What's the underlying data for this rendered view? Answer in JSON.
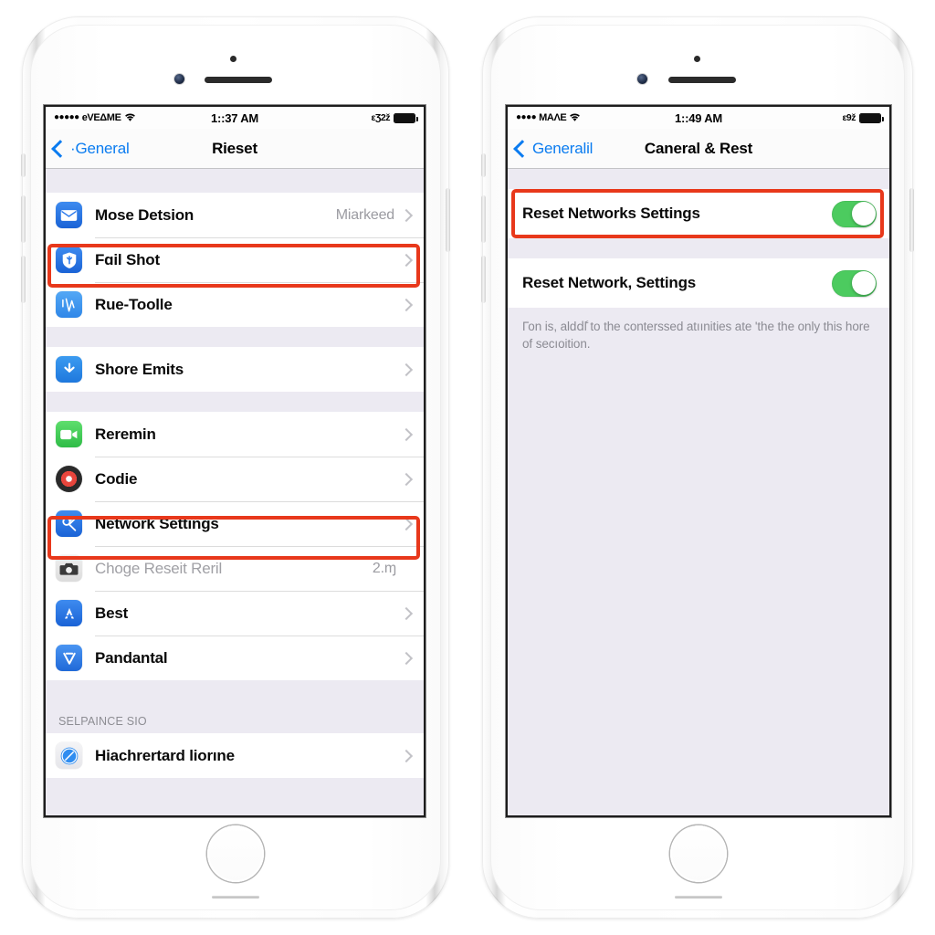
{
  "left_phone": {
    "status_bar": {
      "signal_dots": "●●●●●",
      "carrier": "eVEΔME",
      "wifi_icon": "wifi-icon",
      "time": "1::37 AM",
      "bluetooth": "εƷ2ž",
      "battery_icon": "battery-full-icon"
    },
    "nav": {
      "back_label": "·General",
      "title": "Rieset"
    },
    "groups": [
      {
        "rows": [
          {
            "label": "Mose Detsion",
            "value": "Miarkeed",
            "icon": "mail-icon",
            "icon_class": "ico-mail",
            "glyph": "✉",
            "dim": false,
            "highlight": false
          },
          {
            "label": "Fɑil Shot",
            "value": "",
            "icon": "shield-icon",
            "icon_class": "ico-shield",
            "glyph": "Ⓨ",
            "dim": false,
            "highlight": true
          },
          {
            "label": "Rue-Toolle",
            "value": "",
            "icon": "wave-icon",
            "icon_class": "ico-wave",
            "glyph": "Ⓥ",
            "dim": false,
            "highlight": false
          }
        ]
      },
      {
        "rows": [
          {
            "label": "Shore Emits",
            "value": "",
            "icon": "download-arrow-icon",
            "icon_class": "ico-arrow",
            "glyph": "⬇",
            "dim": false,
            "highlight": false
          }
        ]
      },
      {
        "rows": [
          {
            "label": "Reremin",
            "value": "",
            "icon": "facetime-camera-icon",
            "icon_class": "ico-facetime",
            "glyph": "▶",
            "dim": false,
            "highlight": false
          },
          {
            "label": "Codie",
            "value": "",
            "icon": "chrome-icon",
            "icon_class": "ico-chrome",
            "glyph": "",
            "dim": false,
            "highlight": false
          },
          {
            "label": "Network Settings",
            "value": "",
            "icon": "network-settings-icon",
            "icon_class": "ico-net",
            "glyph": "✂",
            "dim": false,
            "highlight": true
          },
          {
            "label": "Choge Reseit Reril",
            "value": "2.ɱ",
            "icon": "camera-icon",
            "icon_class": "ico-camera",
            "glyph": "📷",
            "dim": true,
            "highlight": false
          },
          {
            "label": "Best",
            "value": "",
            "icon": "app-store-icon",
            "icon_class": "ico-appstore",
            "glyph": "A",
            "dim": false,
            "highlight": false
          },
          {
            "label": "Pandantal",
            "value": "",
            "icon": "vee-icon",
            "icon_class": "ico-vee",
            "glyph": "Ⓥ",
            "dim": false,
            "highlight": false
          }
        ]
      }
    ],
    "section_header": "SELPAINCE SıO",
    "last_group": {
      "rows": [
        {
          "label": "Hiachrertard liorıne",
          "value": "",
          "icon": "safari-compass-icon",
          "icon_class": "ico-safari",
          "glyph": "⦿",
          "dim": false,
          "highlight": false
        }
      ]
    }
  },
  "right_phone": {
    "status_bar": {
      "signal_dots": "●●●●",
      "carrier": "MAΛE",
      "wifi_icon": "wifi-icon",
      "time": "1::49 AM",
      "bluetooth": "ε9ž",
      "battery_icon": "battery-full-icon"
    },
    "nav": {
      "back_label": "Generalil",
      "title": "Caneral & Rest"
    },
    "rows": [
      {
        "label": "Reset Networks Settings",
        "toggle": "on",
        "highlight": true
      },
      {
        "label": "Reset Network, Settings",
        "toggle": "on",
        "highlight": false
      }
    ],
    "footnote": "Гоn іѕ, alddٔl to the conterssed atıınities ate 'the the only this hore of secıoition."
  },
  "colors": {
    "highlight": "#e8381b",
    "toggle_on": "#4ccb5f",
    "link_blue": "#0b7cf0",
    "list_bg": "#eceaf2",
    "row_bg": "#ffffff",
    "separator": "#dcdcdc",
    "dim_text": "#a0a0a5"
  }
}
